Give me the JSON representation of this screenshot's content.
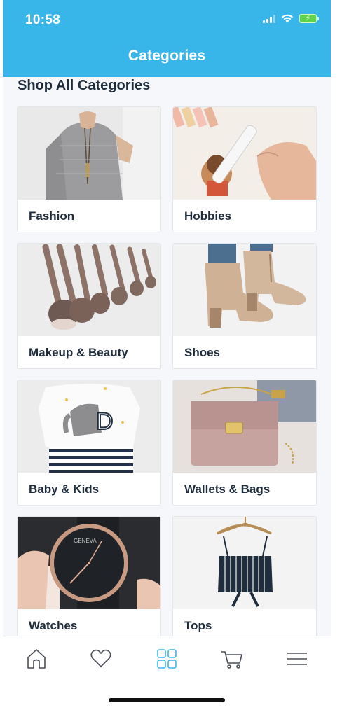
{
  "status_bar": {
    "time": "10:58"
  },
  "header": {
    "title": "Categories"
  },
  "section": {
    "heading": "Shop All Categories"
  },
  "categories": [
    {
      "label": "Fashion"
    },
    {
      "label": "Hobbies"
    },
    {
      "label": "Makeup & Beauty"
    },
    {
      "label": "Shoes"
    },
    {
      "label": "Baby & Kids"
    },
    {
      "label": "Wallets & Bags"
    },
    {
      "label": "Watches"
    },
    {
      "label": "Tops"
    }
  ],
  "tabbar": {
    "items": [
      {
        "icon": "home-icon",
        "active": false
      },
      {
        "icon": "heart-icon",
        "active": false
      },
      {
        "icon": "grid-icon",
        "active": true
      },
      {
        "icon": "cart-icon",
        "active": false
      },
      {
        "icon": "menu-icon",
        "active": false
      }
    ]
  },
  "colors": {
    "brand": "#38b6ea",
    "text": "#1f2d3d",
    "tab_inactive": "#4a4f57",
    "tab_active": "#38b6ea"
  }
}
